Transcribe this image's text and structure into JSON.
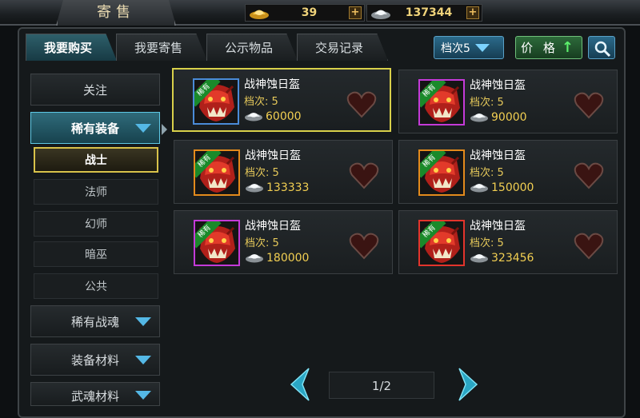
{
  "header": {
    "title": "寄售",
    "gold_amount": "39",
    "silver_amount": "137344",
    "plus_label": "+"
  },
  "tabs": [
    {
      "label": "我要购买",
      "active": true
    },
    {
      "label": "我要寄售",
      "active": false
    },
    {
      "label": "公示物品",
      "active": false
    },
    {
      "label": "交易记录",
      "active": false
    }
  ],
  "filters": {
    "tier_label": "档次5",
    "price_label": "价 格",
    "price_sort_arrow": "↑"
  },
  "sidebar": {
    "follow": "关注",
    "rare_equipment": "稀有装备",
    "subclasses": [
      "战士",
      "法师",
      "幻师",
      "暗巫",
      "公共"
    ],
    "selected_subclass": "战士",
    "rare_soul": "稀有战魂",
    "equip_material": "装备材料",
    "soul_material": "武魂材料"
  },
  "items": [
    {
      "name": "战神蚀日盔",
      "tier": "档次: 5",
      "price": "60000",
      "rarity": "稀有",
      "frame_color": "#4a8bd8",
      "selected": true
    },
    {
      "name": "战神蚀日盔",
      "tier": "档次: 5",
      "price": "90000",
      "rarity": "稀有",
      "frame_color": "#c43ad8",
      "selected": false
    },
    {
      "name": "战神蚀日盔",
      "tier": "档次: 5",
      "price": "133333",
      "rarity": "稀有",
      "frame_color": "#e38a1c",
      "selected": false
    },
    {
      "name": "战神蚀日盔",
      "tier": "档次: 5",
      "price": "150000",
      "rarity": "稀有",
      "frame_color": "#e38a1c",
      "selected": false
    },
    {
      "name": "战神蚀日盔",
      "tier": "档次: 5",
      "price": "180000",
      "rarity": "稀有",
      "frame_color": "#c43ad8",
      "selected": false
    },
    {
      "name": "战神蚀日盔",
      "tier": "档次: 5",
      "price": "323456",
      "rarity": "稀有",
      "frame_color": "#e3342c",
      "selected": false
    }
  ],
  "pagination": {
    "label": "1/2",
    "current": 1,
    "total": 2
  },
  "icons": {
    "gold": "gold-ingot-icon",
    "silver": "silver-ingot-icon",
    "heart": "heart-icon",
    "search": "search-icon",
    "dropdown": "chevron-down-icon",
    "prev": "arrow-left-icon",
    "next": "arrow-right-icon"
  },
  "colors": {
    "accent_gold": "#f2cf52",
    "selected_border": "#d8d04a",
    "rare_tag": "#1a8a2a"
  }
}
